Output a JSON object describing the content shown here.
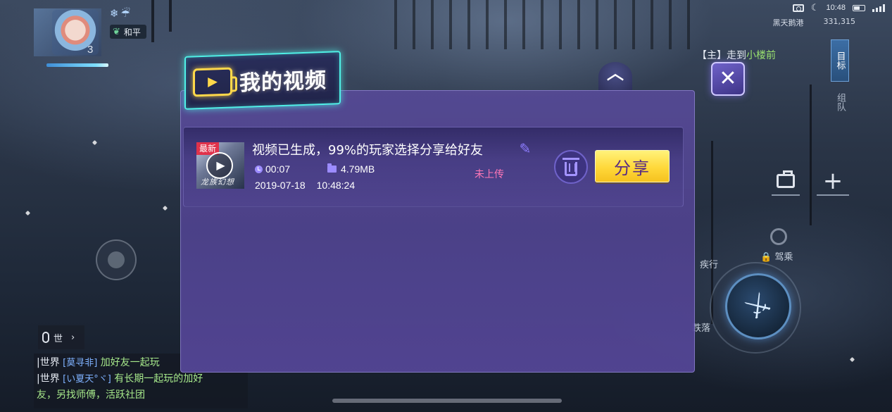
{
  "hud": {
    "player_level": "3",
    "status_icons": "❄☔",
    "mode_badge": "和平",
    "location_text": "黑天鹅港",
    "coordinates": "331,315",
    "time": "10:48",
    "quest_prefix": "【主】",
    "quest_verb": "走到",
    "quest_target": "小楼前",
    "side_tab_target": "目标",
    "side_tab_team": "组队",
    "action_ride": "驾乘",
    "action_sprint": "疾行",
    "action_fall": "跌落"
  },
  "chat": {
    "toggle_label": "世",
    "lines": [
      {
        "channel": "|世界",
        "name": "[莫寻非]",
        "message": "加好友一起玩"
      },
      {
        "channel": "|世界",
        "name": "[い夏天°ヾ]",
        "message": "有长期一起玩的加好"
      },
      {
        "channel": "",
        "name": "",
        "message": "友，另找师傅，活跃社团"
      }
    ]
  },
  "panel": {
    "title": "我的视频",
    "video": {
      "badge": "最新",
      "thumb_logo": "龙族幻想",
      "title": "视频已生成，99%的玩家选择分享给好友",
      "duration": "00:07",
      "size": "4.79MB",
      "date": "2019-07-18",
      "time": "10:48:24",
      "upload_status": "未上传"
    },
    "share_label": "分享"
  },
  "icons": {
    "close": "close-icon",
    "collapse": "chevron-up-icon",
    "edit": "pencil-icon",
    "delete": "trash-icon",
    "play": "play-icon",
    "bag": "toolbox-icon",
    "plus": "plus-icon",
    "skill": "sword-icon"
  },
  "colors": {
    "panel_border_glow": "#4ff0e6",
    "share_button": "#ffd83a",
    "upload_status": "#ff77b7",
    "accent_purple": "#8e7dff"
  }
}
